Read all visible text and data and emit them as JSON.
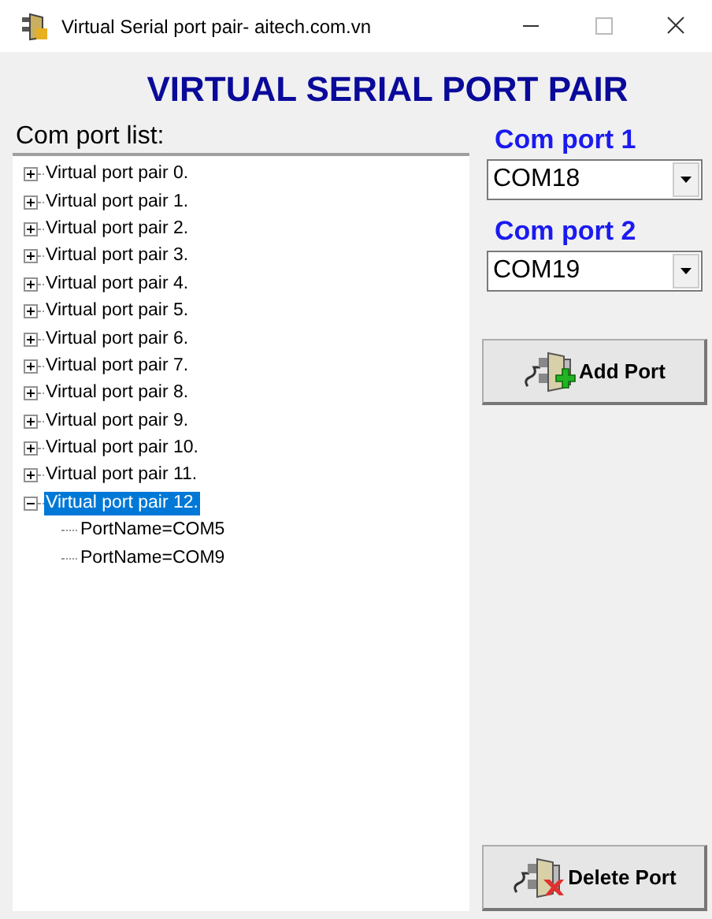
{
  "window": {
    "title": "Virtual Serial port pair- aitech.com.vn"
  },
  "heading": "VIRTUAL SERIAL PORT PAIR",
  "tree_label": "Com port list:",
  "tree": {
    "items": [
      {
        "label": "Virtual port pair 0.",
        "expanded": false,
        "selected": false
      },
      {
        "label": "Virtual port pair 1.",
        "expanded": false,
        "selected": false
      },
      {
        "label": "Virtual port pair 2.",
        "expanded": false,
        "selected": false
      },
      {
        "label": "Virtual port pair 3.",
        "expanded": false,
        "selected": false
      },
      {
        "label": "Virtual port pair 4.",
        "expanded": false,
        "selected": false
      },
      {
        "label": "Virtual port pair 5.",
        "expanded": false,
        "selected": false
      },
      {
        "label": "Virtual port pair 6.",
        "expanded": false,
        "selected": false
      },
      {
        "label": "Virtual port pair 7.",
        "expanded": false,
        "selected": false
      },
      {
        "label": "Virtual port pair 8.",
        "expanded": false,
        "selected": false
      },
      {
        "label": "Virtual port pair 9.",
        "expanded": false,
        "selected": false
      },
      {
        "label": "Virtual port pair 10.",
        "expanded": false,
        "selected": false
      },
      {
        "label": "Virtual port pair 11.",
        "expanded": false,
        "selected": false
      },
      {
        "label": "Virtual port pair 12.",
        "expanded": true,
        "selected": true,
        "children": [
          {
            "label": "PortName=COM5"
          },
          {
            "label": "PortName=COM9"
          }
        ]
      }
    ]
  },
  "ports": [
    {
      "label": "Com port 1",
      "value": "COM18"
    },
    {
      "label": "Com port 2",
      "value": "COM19"
    }
  ],
  "buttons": [
    {
      "kind": "add",
      "label": "Add Port"
    },
    {
      "kind": "delete",
      "label": "Delete Port"
    }
  ]
}
